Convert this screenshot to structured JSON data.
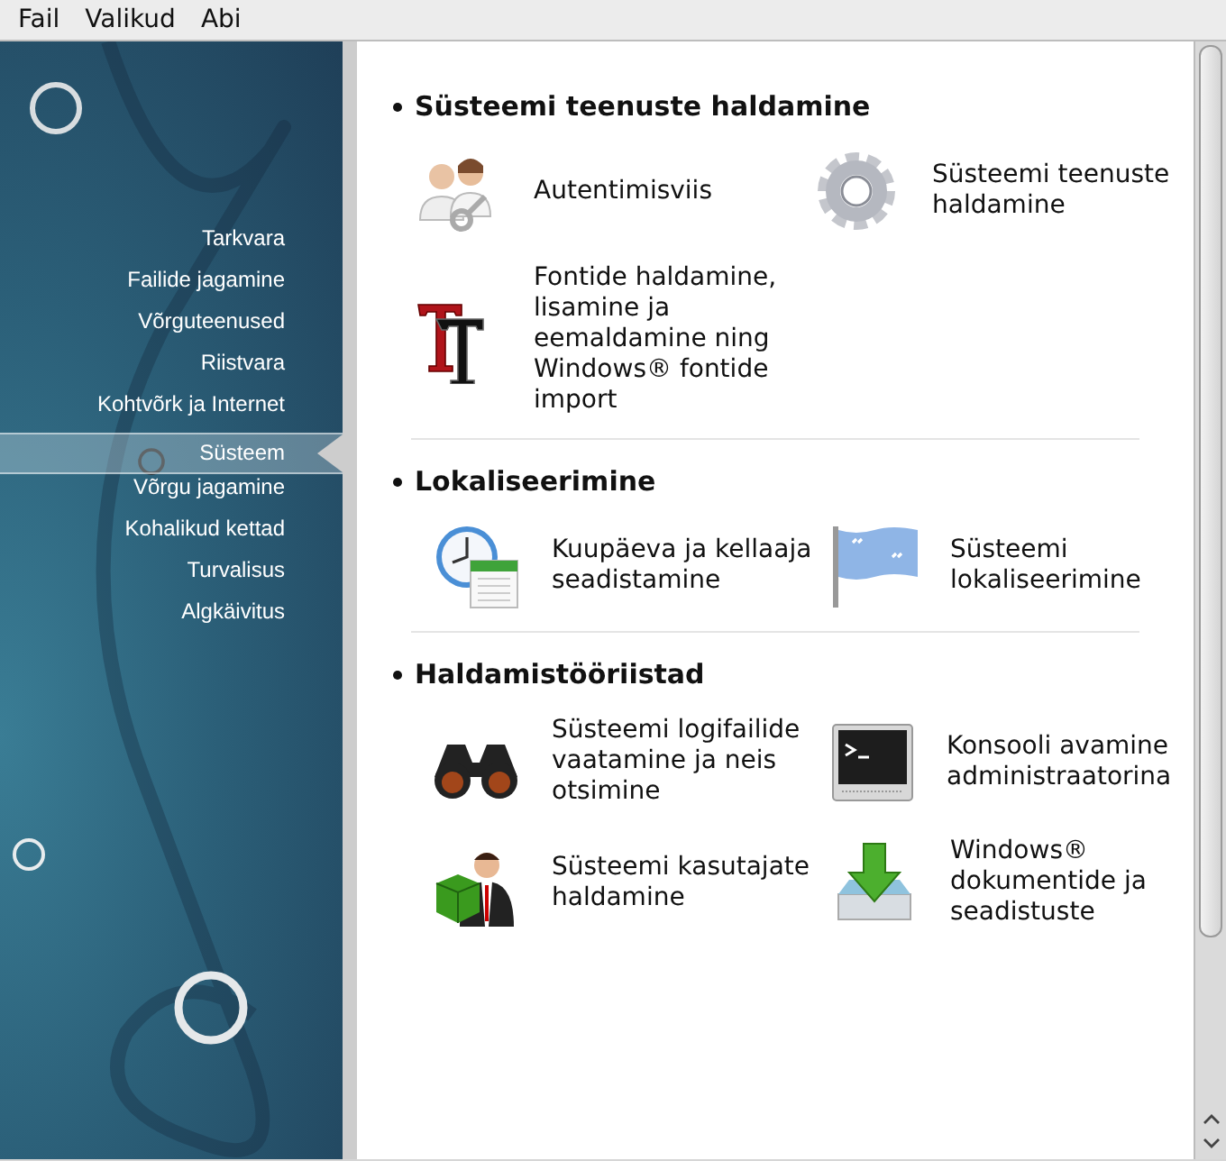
{
  "menu": [
    "Fail",
    "Valikud",
    "Abi"
  ],
  "sidebar": {
    "items": [
      {
        "label": "Tarkvara",
        "selected": false
      },
      {
        "label": "Failide jagamine",
        "selected": false
      },
      {
        "label": "Võrguteenused",
        "selected": false
      },
      {
        "label": "Riistvara",
        "selected": false
      },
      {
        "label": "Kohtvõrk ja Internet",
        "selected": false
      },
      {
        "label": "Süsteem",
        "selected": true
      },
      {
        "label": "Võrgu jagamine",
        "selected": false
      },
      {
        "label": "Kohalikud kettad",
        "selected": false
      },
      {
        "label": "Turvalisus",
        "selected": false
      },
      {
        "label": "Algkäivitus",
        "selected": false
      }
    ]
  },
  "sections": [
    {
      "title": "Süsteemi teenuste haldamine",
      "items": [
        "Autentimisviis",
        "Süsteemi teenuste haldamine",
        "Fontide haldamine, lisamine ja eemaldamine ning Windows® fontide import"
      ]
    },
    {
      "title": "Lokaliseerimine",
      "items": [
        "Kuupäeva ja kellaaja seadistamine",
        "Süsteemi lokaliseerimine"
      ]
    },
    {
      "title": "Haldamistööriistad",
      "items": [
        "Süsteemi logifailide vaatamine ja neis otsimine",
        "Konsooli avamine administraatorina",
        "Süsteemi kasutajate haldamine",
        "Windows® dokumentide ja seadistuste"
      ]
    }
  ]
}
